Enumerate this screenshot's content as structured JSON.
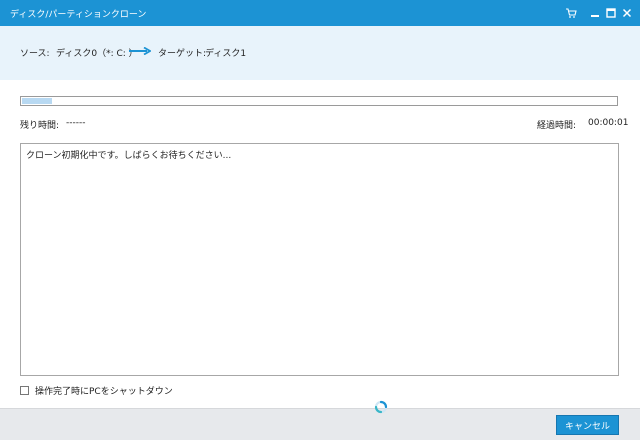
{
  "window": {
    "title": "ディスク/パーティションクローン",
    "controls": [
      "cart-icon",
      "minimize-icon",
      "maximize-icon",
      "close-icon"
    ]
  },
  "header": {
    "source_label": "ソース:",
    "source_value": "ディスク0（*: C: ）",
    "arrow_icon": "arrow-right-icon",
    "target_label": "ターゲット:",
    "target_value": "ディスク1"
  },
  "progress": {
    "fraction": 0.05,
    "remaining_label": "残り時間:",
    "remaining_value": "------",
    "elapsed_label": "経過時間:",
    "elapsed_value": "00:00:01"
  },
  "log": {
    "lines": [
      "クローン初期化中です。しばらくお待ちください..."
    ]
  },
  "options": {
    "shutdown_label": "操作完了時にPCをシャットダウン",
    "shutdown_checked": false
  },
  "footer": {
    "spinner_icon": "loading-spinner-icon",
    "cancel_label": "キャンセル"
  },
  "colors": {
    "accent": "#1c93d4",
    "header_bg": "#e8f3fb",
    "progress_fill": "#b8d9f2"
  }
}
